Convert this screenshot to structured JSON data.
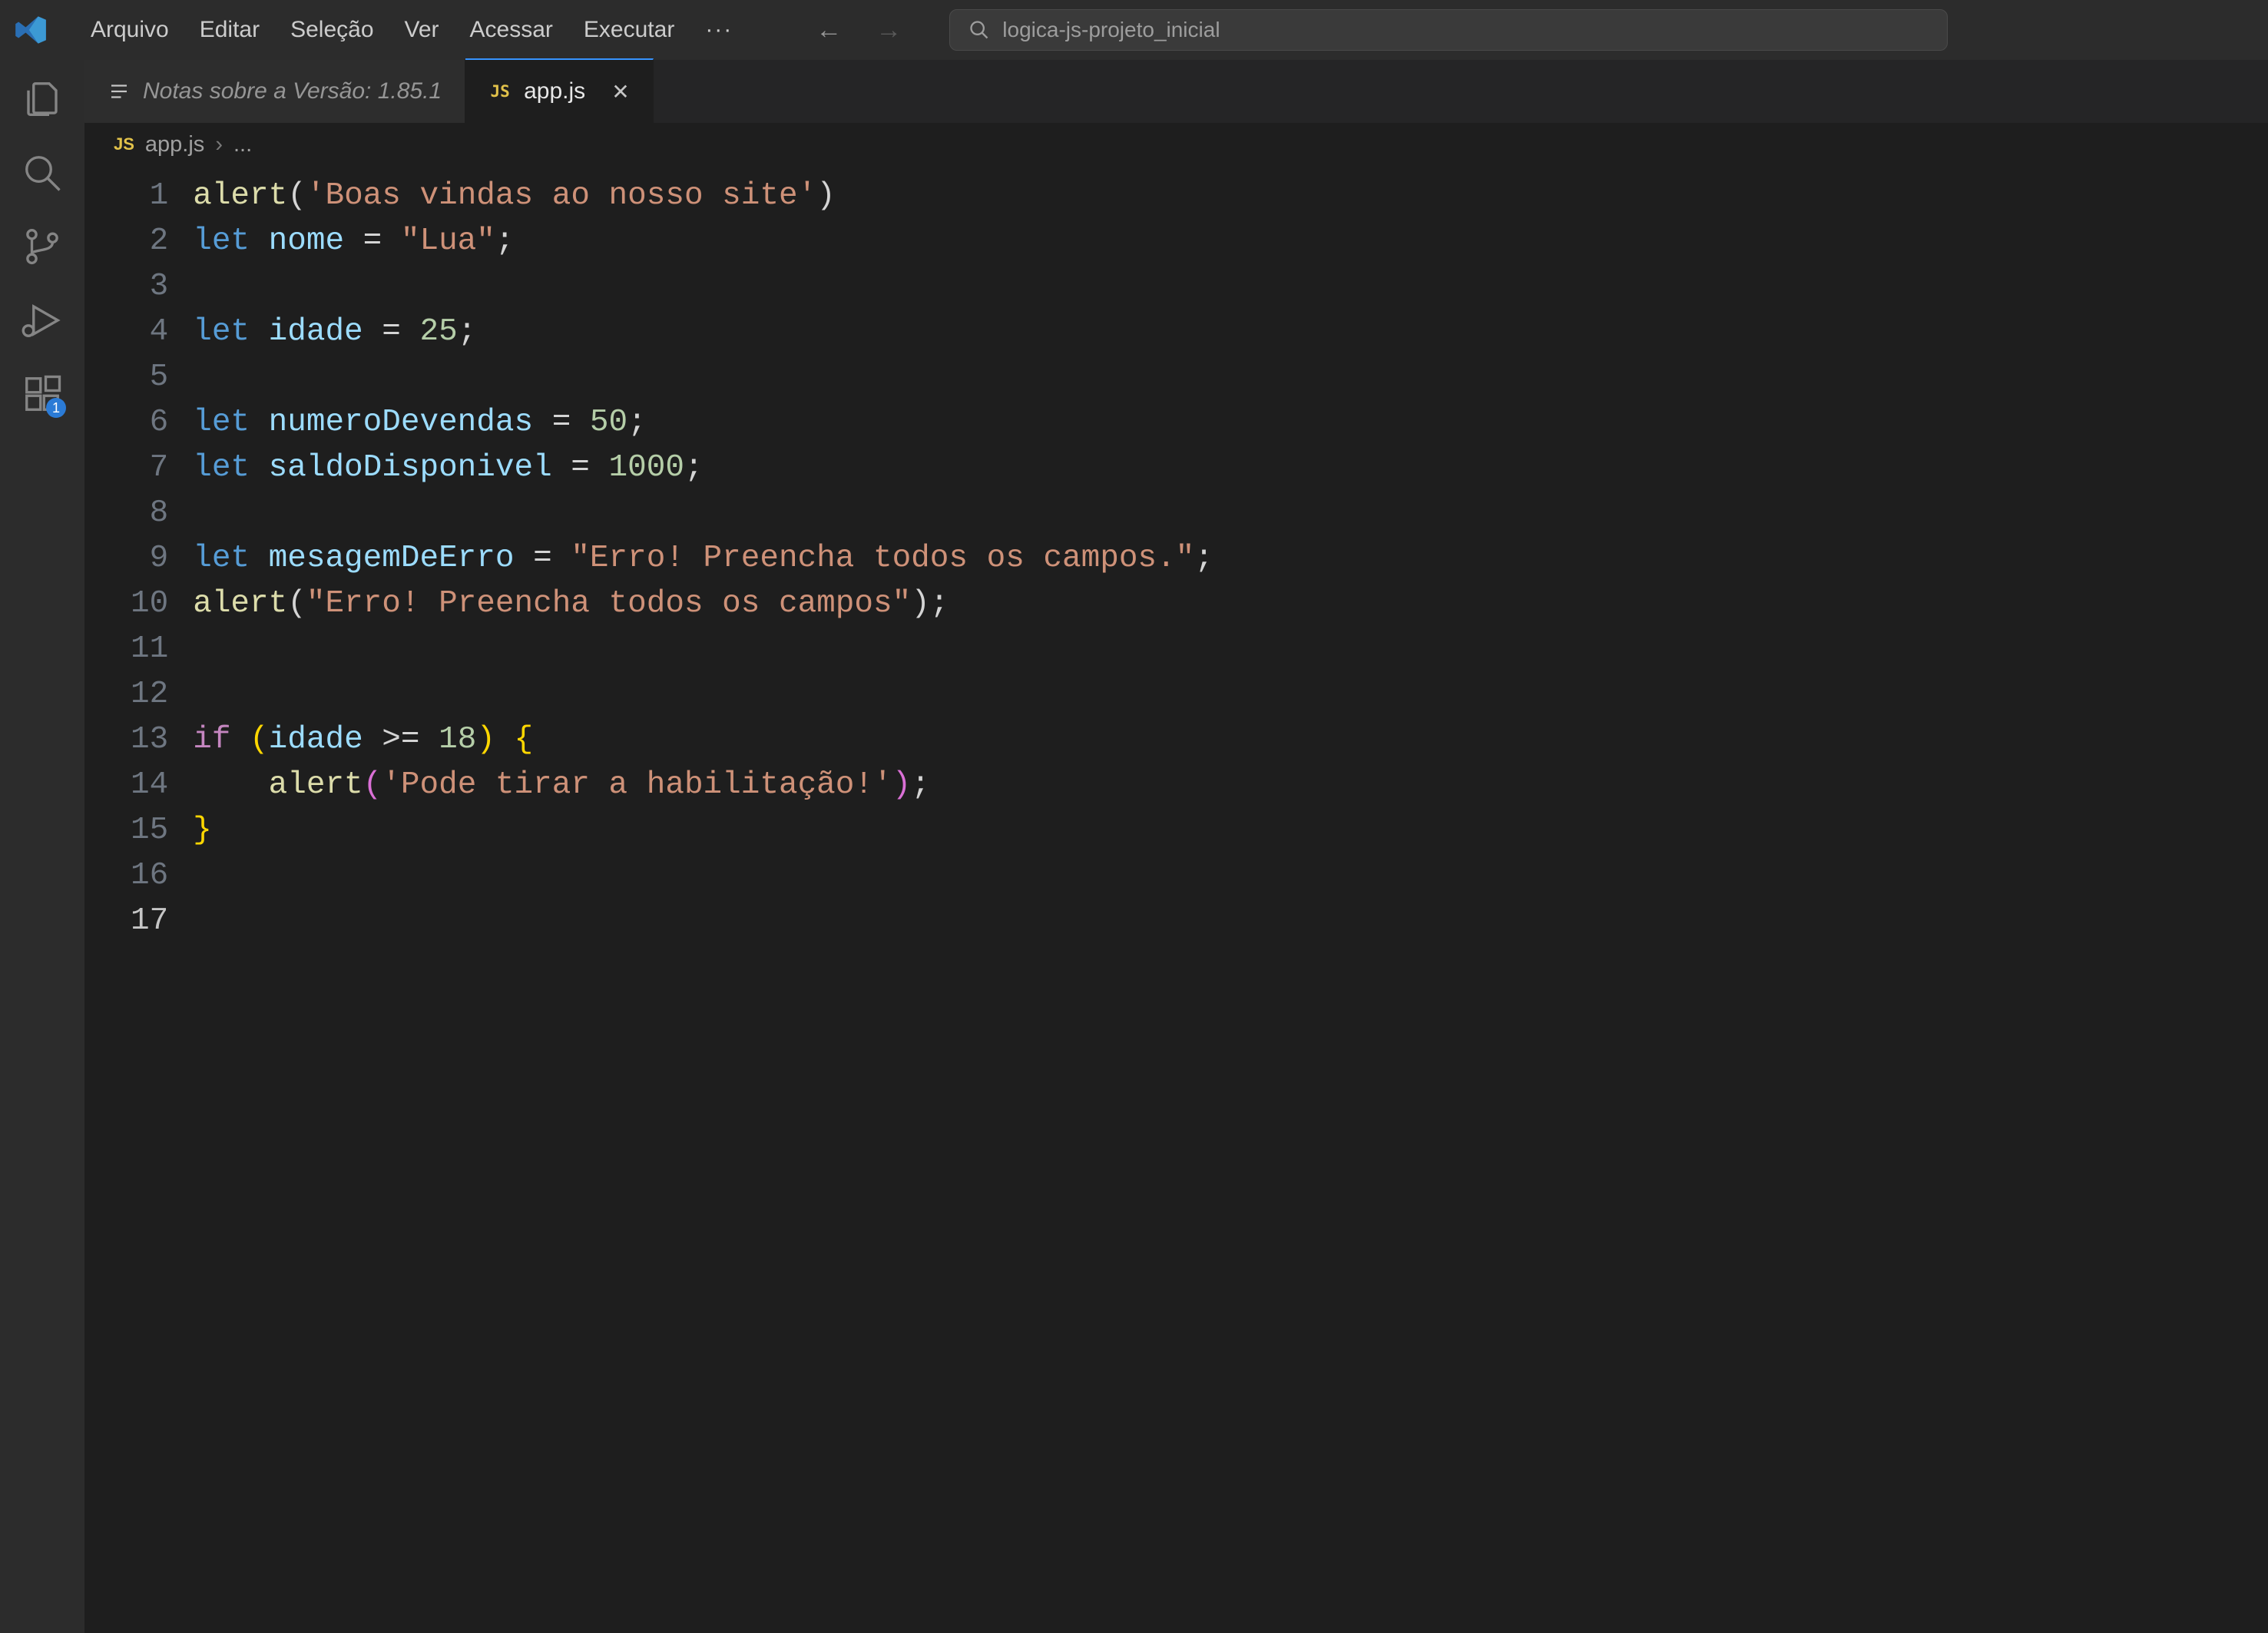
{
  "menubar": {
    "items": [
      "Arquivo",
      "Editar",
      "Seleção",
      "Ver",
      "Acessar",
      "Executar"
    ],
    "ellipsis": "···"
  },
  "search": {
    "placeholder": "logica-js-projeto_inicial"
  },
  "activitybar": {
    "extensions_badge": "1"
  },
  "tabs": [
    {
      "icon": "release-notes",
      "label": "Notas sobre a Versão: 1.85.1",
      "active": false,
      "closeable": false
    },
    {
      "icon": "js",
      "label": "app.js",
      "active": true,
      "closeable": true
    }
  ],
  "breadcrumb": {
    "file_icon": "JS",
    "file": "app.js",
    "sep": "›",
    "tail": "..."
  },
  "code": {
    "lines": [
      [
        {
          "t": "fn",
          "v": "alert"
        },
        {
          "t": "pun",
          "v": "("
        },
        {
          "t": "str",
          "v": "'Boas vindas ao nosso site'"
        },
        {
          "t": "pun",
          "v": ")"
        }
      ],
      [
        {
          "t": "kw",
          "v": "let"
        },
        {
          "t": "pun",
          "v": " "
        },
        {
          "t": "var",
          "v": "nome"
        },
        {
          "t": "pun",
          "v": " = "
        },
        {
          "t": "str",
          "v": "\"Lua\""
        },
        {
          "t": "pun",
          "v": ";"
        }
      ],
      [],
      [
        {
          "t": "kw",
          "v": "let"
        },
        {
          "t": "pun",
          "v": " "
        },
        {
          "t": "var",
          "v": "idade"
        },
        {
          "t": "pun",
          "v": " = "
        },
        {
          "t": "num",
          "v": "25"
        },
        {
          "t": "pun",
          "v": ";"
        }
      ],
      [],
      [
        {
          "t": "kw",
          "v": "let"
        },
        {
          "t": "pun",
          "v": " "
        },
        {
          "t": "var",
          "v": "numeroDevendas"
        },
        {
          "t": "pun",
          "v": " = "
        },
        {
          "t": "num",
          "v": "50"
        },
        {
          "t": "pun",
          "v": ";"
        }
      ],
      [
        {
          "t": "kw",
          "v": "let"
        },
        {
          "t": "pun",
          "v": " "
        },
        {
          "t": "var",
          "v": "saldoDisponivel"
        },
        {
          "t": "pun",
          "v": " = "
        },
        {
          "t": "num",
          "v": "1000"
        },
        {
          "t": "pun",
          "v": ";"
        }
      ],
      [],
      [
        {
          "t": "kw",
          "v": "let"
        },
        {
          "t": "pun",
          "v": " "
        },
        {
          "t": "var",
          "v": "mesagemDeErro"
        },
        {
          "t": "pun",
          "v": " = "
        },
        {
          "t": "str",
          "v": "\"Erro! Preencha todos os campos.\""
        },
        {
          "t": "pun",
          "v": ";"
        }
      ],
      [
        {
          "t": "fn",
          "v": "alert"
        },
        {
          "t": "pun",
          "v": "("
        },
        {
          "t": "str",
          "v": "\"Erro! Preencha todos os campos\""
        },
        {
          "t": "pun",
          "v": ");"
        }
      ],
      [],
      [],
      [
        {
          "t": "ctl",
          "v": "if"
        },
        {
          "t": "pun",
          "v": " "
        },
        {
          "t": "brc",
          "v": "("
        },
        {
          "t": "var",
          "v": "idade"
        },
        {
          "t": "pun",
          "v": " >= "
        },
        {
          "t": "num",
          "v": "18"
        },
        {
          "t": "brc",
          "v": ")"
        },
        {
          "t": "pun",
          "v": " "
        },
        {
          "t": "brc",
          "v": "{"
        }
      ],
      [
        {
          "t": "guide",
          "v": "    "
        },
        {
          "t": "fn",
          "v": "alert"
        },
        {
          "t": "brc2",
          "v": "("
        },
        {
          "t": "str",
          "v": "'Pode tirar a habilitação!'"
        },
        {
          "t": "brc2",
          "v": ")"
        },
        {
          "t": "pun",
          "v": ";"
        }
      ],
      [
        {
          "t": "brc",
          "v": "}"
        }
      ],
      [],
      []
    ],
    "current_line": 17
  }
}
